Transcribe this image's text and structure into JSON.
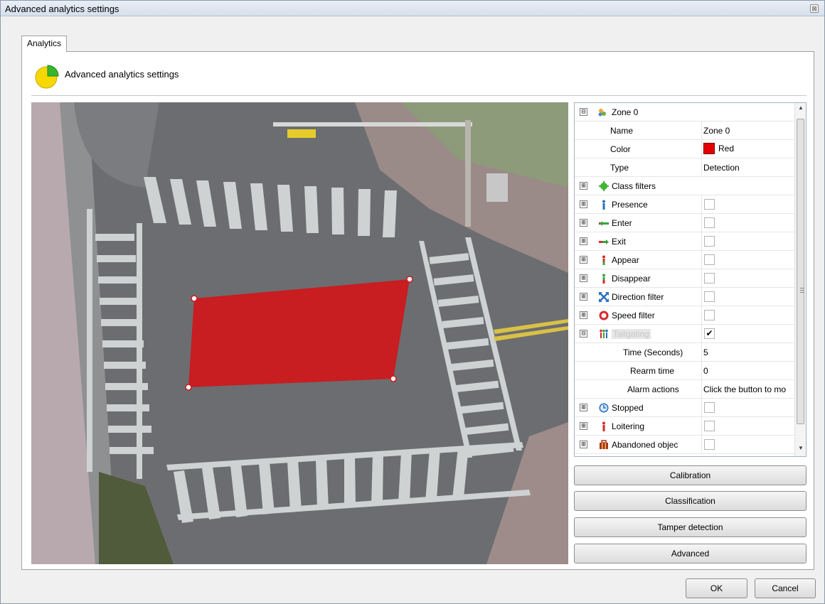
{
  "window": {
    "title": "Advanced analytics settings",
    "close_glyph": "⊠"
  },
  "tabs": [
    {
      "label": "Analytics"
    }
  ],
  "header": {
    "text": "Advanced analytics settings",
    "icon": "pie-chart-icon"
  },
  "zone_editor": {
    "polygon_color": "#d0171a",
    "vertex_count": 4
  },
  "property_grid": {
    "zone": {
      "label": "Zone 0",
      "expander": "⊟"
    },
    "name": {
      "label": "Name",
      "value": "Zone 0"
    },
    "color": {
      "label": "Color",
      "value": "Red",
      "swatch": "#e30000"
    },
    "type": {
      "label": "Type",
      "value": "Detection"
    },
    "items": [
      {
        "label": "Class filters",
        "icon": "gear-icon",
        "expander": "⊞"
      },
      {
        "label": "Presence",
        "icon": "person-icon",
        "expander": "⊞",
        "checked": false
      },
      {
        "label": "Enter",
        "icon": "enter-arrow-icon",
        "expander": "⊞",
        "checked": false
      },
      {
        "label": "Exit",
        "icon": "exit-arrow-icon",
        "expander": "⊞",
        "checked": false
      },
      {
        "label": "Appear",
        "icon": "appear-person-icon",
        "expander": "⊞",
        "checked": false
      },
      {
        "label": "Disappear",
        "icon": "disappear-person-icon",
        "expander": "⊞",
        "checked": false
      },
      {
        "label": "Direction filter",
        "icon": "direction-arrows-icon",
        "expander": "⊞",
        "checked": false
      },
      {
        "label": "Speed filter",
        "icon": "speed-sign-icon",
        "expander": "⊞",
        "checked": false
      },
      {
        "label": "Tailgating",
        "icon": "tailgating-people-icon",
        "expander": "⊟",
        "checked": true,
        "check_glyph": "✔"
      }
    ],
    "tailgating_children": [
      {
        "label": "Time (Seconds)",
        "value": "5"
      },
      {
        "label": "Rearm time",
        "value": "0"
      },
      {
        "label": "Alarm actions",
        "value": "Click the button to mo"
      }
    ],
    "items_after": [
      {
        "label": "Stopped",
        "icon": "clock-icon",
        "expander": "⊞",
        "checked": false
      },
      {
        "label": "Loitering",
        "icon": "loitering-person-icon",
        "expander": "⊞",
        "checked": false
      },
      {
        "label": "Abandoned objec",
        "icon": "abandoned-object-icon",
        "expander": "⊞",
        "checked": false
      }
    ]
  },
  "buttons": {
    "calibration": "Calibration",
    "classification": "Classification",
    "tamper": "Tamper detection",
    "advanced": "Advanced",
    "ok": "OK",
    "cancel": "Cancel"
  }
}
